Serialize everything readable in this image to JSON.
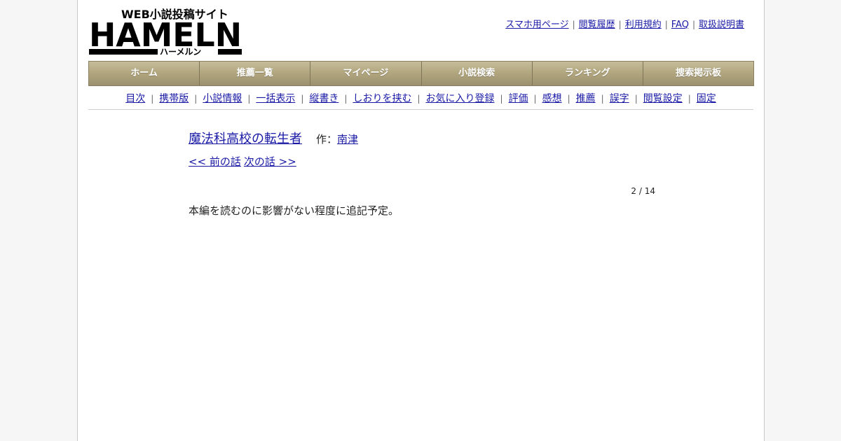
{
  "header": {
    "logo_text": "HAMELN",
    "logo_tagline": "WEB小説投稿サイト",
    "logo_kana": "ハーメルン",
    "links": [
      "スマホ用ページ",
      "閲覧履歴",
      "利用規約",
      "FAQ",
      "取扱説明書"
    ]
  },
  "nav": [
    "ホーム",
    "推薦一覧",
    "マイページ",
    "小説検索",
    "ランキング",
    "捜索掲示板"
  ],
  "subnav": [
    "目次",
    "携帯版",
    "小説情報",
    "一括表示",
    "縦書き",
    "しおりを挟む",
    "お気に入り登録",
    "評価",
    "感想",
    "推薦",
    "誤字",
    "閲覧設定",
    "固定"
  ],
  "novel": {
    "title": "魔法科高校の転生者",
    "author_label": "作：",
    "author": "南津",
    "prev": "<< 前の話",
    "next": "次の話 >>",
    "count": "2 / 14",
    "text": "本編を読むのに影響がない程度に追記予定。"
  },
  "colors": {
    "link": "#1a1aa6",
    "nav_bg": "#b2a77f"
  }
}
